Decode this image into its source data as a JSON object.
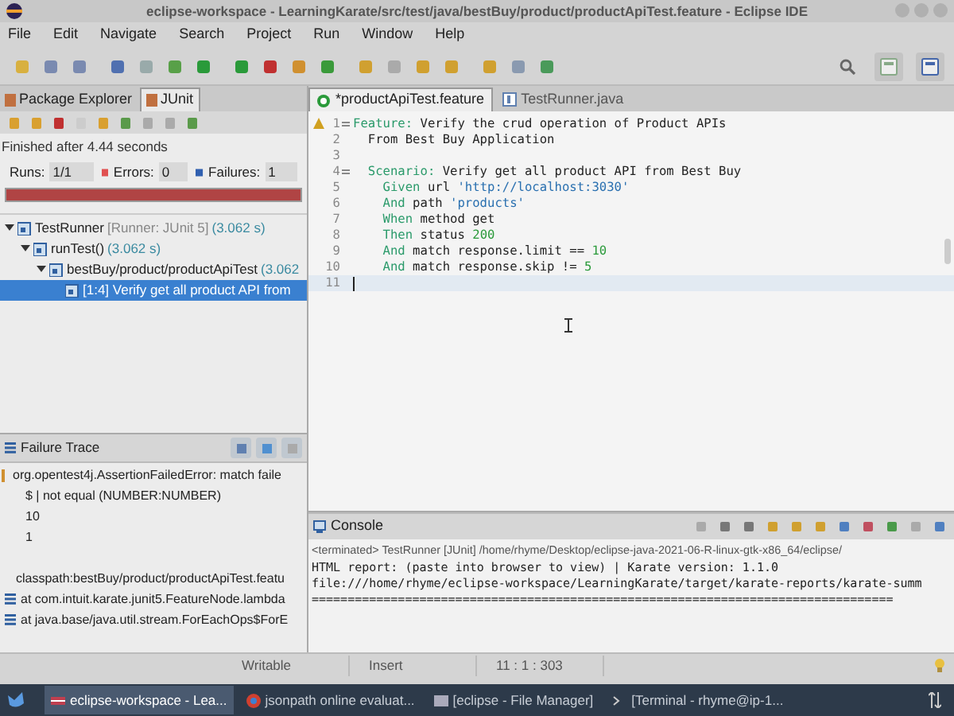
{
  "window": {
    "title": "eclipse-workspace - LearningKarate/src/test/java/bestBuy/product/productApiTest.feature - Eclipse IDE"
  },
  "menu": [
    "File",
    "Edit",
    "Navigate",
    "Search",
    "Project",
    "Run",
    "Window",
    "Help"
  ],
  "left_tabs": [
    {
      "label": "Package Explorer",
      "selected": false
    },
    {
      "label": "JUnit",
      "selected": true
    }
  ],
  "junit": {
    "status": "Finished after 4.44 seconds",
    "runs_label": "Runs:",
    "runs": "1/1",
    "errors_label": "Errors:",
    "errors": "0",
    "failures_label": "Failures:",
    "failures": "1",
    "failed": true,
    "tree": [
      {
        "label": "TestRunner",
        "detail": "[Runner: JUnit 5]",
        "time": "(3.062 s)",
        "expanded": true,
        "selected": false,
        "children": [
          {
            "label": "runTest()",
            "time": "(3.062 s)",
            "expanded": true,
            "selected": false,
            "children": [
              {
                "label": "bestBuy/product/productApiTest",
                "time": "(3.062",
                "expanded": true,
                "selected": false,
                "children": [
                  {
                    "label": "[1:4] Verify get all product API from",
                    "selected": true
                  }
                ]
              }
            ]
          }
        ]
      }
    ]
  },
  "failure_trace": {
    "title": "Failure Trace",
    "lines": [
      {
        "kind": "error",
        "text": "org.opentest4j.AssertionFailedError: match faile"
      },
      {
        "kind": "plain",
        "text": "$ | not equal (NUMBER:NUMBER)"
      },
      {
        "kind": "plain",
        "text": "10"
      },
      {
        "kind": "plain",
        "text": "1"
      },
      {
        "kind": "blank"
      },
      {
        "kind": "path",
        "text": "classpath:bestBuy/product/productApiTest.featu"
      },
      {
        "kind": "frame",
        "text": "at com.intuit.karate.junit5.FeatureNode.lambda"
      },
      {
        "kind": "frame",
        "text": "at java.base/java.util.stream.ForEachOps$ForE"
      }
    ]
  },
  "editor_tabs": [
    {
      "label": "*productApiTest.feature",
      "selected": true
    },
    {
      "label": "TestRunner.java",
      "selected": false
    }
  ],
  "code": [
    {
      "number": "1",
      "fold": true,
      "current": false,
      "segments": [
        {
          "kind": "keyword",
          "text": "Feature:"
        },
        {
          "kind": "plain",
          "text": " Verify the crud operation of Product APIs"
        }
      ]
    },
    {
      "number": "2",
      "fold": false,
      "current": false,
      "segments": [
        {
          "kind": "plain",
          "text": "  From Best Buy Application"
        }
      ]
    },
    {
      "number": "3",
      "fold": false,
      "current": false
    },
    {
      "number": "4",
      "fold": true,
      "current": false,
      "segments": [
        {
          "kind": "keyword",
          "text": "  Scenario:"
        },
        {
          "kind": "plain",
          "text": " Verify get all product API from Best Buy"
        }
      ]
    },
    {
      "number": "5",
      "fold": false,
      "current": false,
      "segments": [
        {
          "kind": "keyword",
          "text": "    Given"
        },
        {
          "kind": "plain",
          "text": " url "
        },
        {
          "kind": "string",
          "text": "'http://localhost:3030'"
        }
      ]
    },
    {
      "number": "6",
      "fold": false,
      "current": false,
      "segments": [
        {
          "kind": "keyword",
          "text": "    And"
        },
        {
          "kind": "plain",
          "text": " path "
        },
        {
          "kind": "string",
          "text": "'products'"
        }
      ]
    },
    {
      "number": "7",
      "fold": false,
      "current": false,
      "segments": [
        {
          "kind": "keyword",
          "text": "    When"
        },
        {
          "kind": "plain",
          "text": " method get"
        }
      ]
    },
    {
      "number": "8",
      "fold": false,
      "current": false,
      "segments": [
        {
          "kind": "keyword",
          "text": "    Then"
        },
        {
          "kind": "plain",
          "text": " status "
        },
        {
          "kind": "number",
          "text": "200"
        }
      ]
    },
    {
      "number": "9",
      "fold": false,
      "current": false,
      "segments": [
        {
          "kind": "keyword",
          "text": "    And"
        },
        {
          "kind": "plain",
          "text": " match response.limit == "
        },
        {
          "kind": "number",
          "text": "10"
        }
      ]
    },
    {
      "number": "10",
      "fold": false,
      "current": false,
      "segments": [
        {
          "kind": "keyword",
          "text": "    And"
        },
        {
          "kind": "plain",
          "text": " match response.skip != "
        },
        {
          "kind": "number",
          "text": "5"
        }
      ]
    },
    {
      "number": "11",
      "fold": false,
      "current": true
    }
  ],
  "console": {
    "title": "Console",
    "terminated": "<terminated> TestRunner [JUnit] /home/rhyme/Desktop/eclipse-java-2021-06-R-linux-gtk-x86_64/eclipse/",
    "lines": [
      "HTML report: (paste into browser to view) | Karate version: 1.1.0",
      "file:///home/rhyme/eclipse-workspace/LearningKarate/target/karate-reports/karate-summ",
      "================================================================================="
    ]
  },
  "status_bar": {
    "writable": "Writable",
    "mode": "Insert",
    "position": "11 : 1 : 303"
  },
  "taskbar": [
    {
      "label": "eclipse-workspace - Lea...",
      "selected": true
    },
    {
      "label": "jsonpath online evaluat...",
      "selected": false
    },
    {
      "label": "[eclipse - File Manager]",
      "selected": false
    },
    {
      "label": "[Terminal - rhyme@ip-1...",
      "selected": false
    }
  ]
}
